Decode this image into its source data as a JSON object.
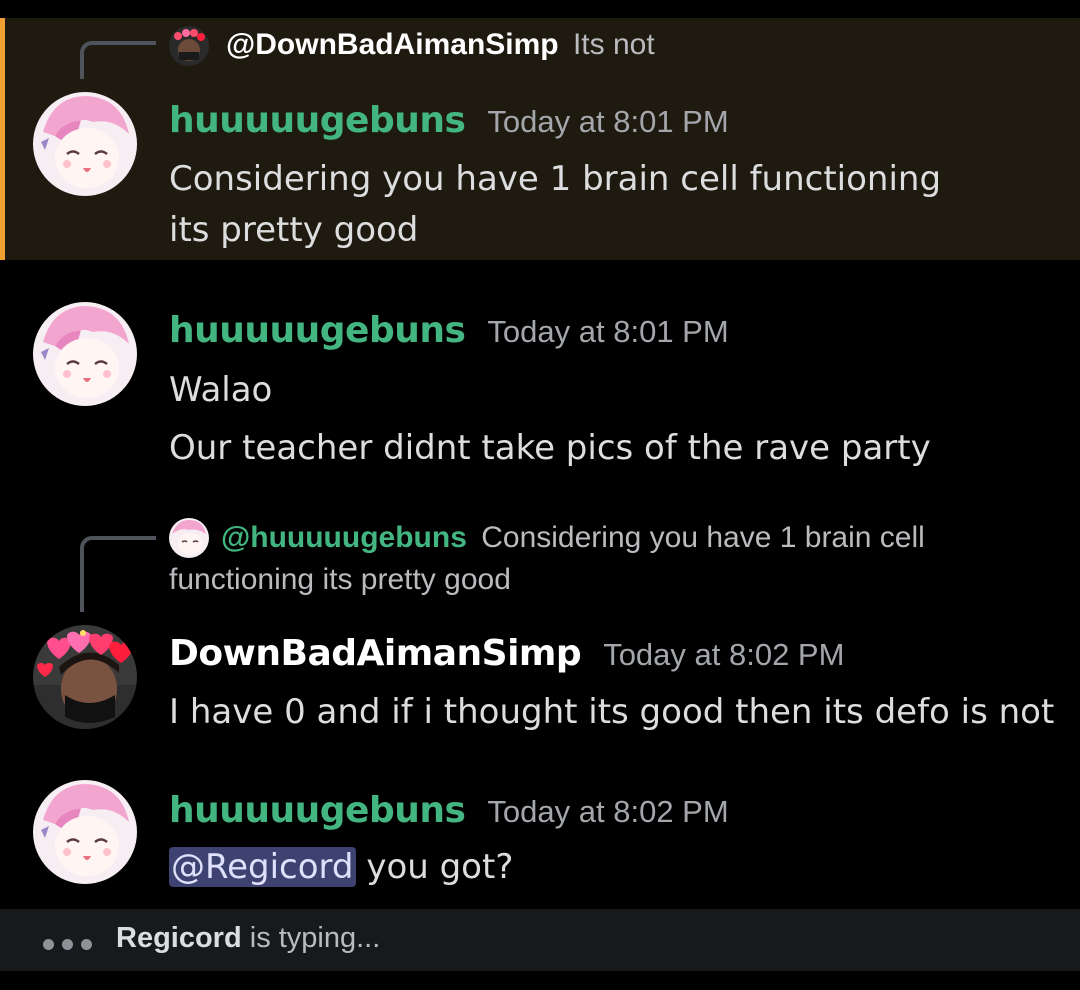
{
  "colors": {
    "background": "#000000",
    "highlight_bg": "#1e1a10",
    "highlight_border": "#f0a030",
    "username_green": "#43b581",
    "username_white": "#ffffff",
    "mention_bg": "#3d4270",
    "typing_bar": "#18191c"
  },
  "messages": [
    {
      "reply": {
        "name": "@DownBadAimanSimp",
        "text": "Its not",
        "avatar": "dark-avatar-with-hearts"
      },
      "username": "huuuuugebuns",
      "timestamp": "Today at 8:01 PM",
      "lines": [
        "Considering you have 1 brain cell functioning its pretty good"
      ],
      "highlighted": true
    },
    {
      "username": "huuuuugebuns",
      "timestamp": "Today at 8:01 PM",
      "lines": [
        "Walao",
        "Our teacher didnt take pics of the rave party"
      ]
    },
    {
      "reply": {
        "name": "@huuuuugebuns",
        "text": "Considering you have 1 brain cell",
        "text2": "functioning its pretty good",
        "avatar": "anime-pink-avatar"
      },
      "username": "DownBadAimanSimp",
      "timestamp": "Today at 8:02 PM",
      "lines": [
        "I have 0 and if i thought its good then its defo is not"
      ]
    },
    {
      "username": "huuuuugebuns",
      "timestamp": "Today at 8:02 PM",
      "mention": "@Regicord",
      "after_mention": " you got?"
    }
  ],
  "typing": {
    "user": "Regicord",
    "suffix": " is typing..."
  }
}
